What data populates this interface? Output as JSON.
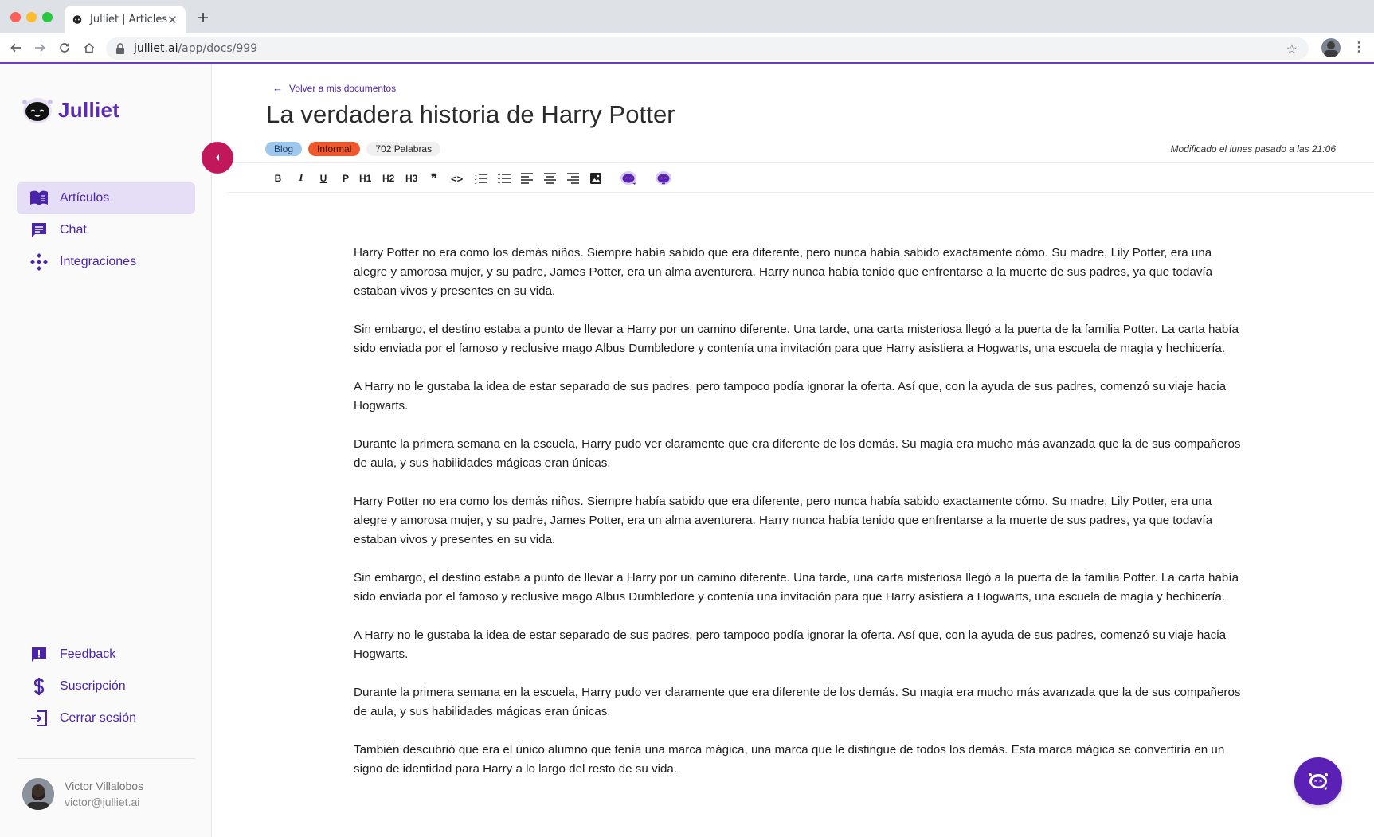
{
  "browser": {
    "tab_title": "Julliet | Articles",
    "tab_close": "✕",
    "new_tab": "+",
    "url_host": "julliet.ai",
    "url_path": "/app/docs/999"
  },
  "brand": {
    "name": "Julliet",
    "accent": "#5b2bb5",
    "collapse_color": "#c2185b"
  },
  "sidebar": {
    "nav": [
      {
        "label": "Artículos",
        "icon": "book-open-icon",
        "active": true
      },
      {
        "label": "Chat",
        "icon": "chat-icon",
        "active": false
      },
      {
        "label": "Integraciones",
        "icon": "integrations-icon",
        "active": false
      }
    ],
    "bottom": [
      {
        "label": "Feedback",
        "icon": "feedback-icon"
      },
      {
        "label": "Suscripción",
        "icon": "dollar-icon"
      },
      {
        "label": "Cerrar sesión",
        "icon": "logout-icon"
      }
    ],
    "user": {
      "name": "Victor Villalobos",
      "email": "victor@julliet.ai"
    }
  },
  "document": {
    "back_label": "Volver a mis documentos",
    "title": "La verdadera historia de Harry Potter",
    "tags": {
      "type": "Blog",
      "tone": "Informal",
      "words": "702 Palabras"
    },
    "modified": "Modificado el lunes pasado a las 21:06",
    "toolbar": {
      "bold": "B",
      "italic": "I",
      "underline": "U",
      "paragraph": "P",
      "h1": "H1",
      "h2": "H2",
      "h3": "H3",
      "quote": "❞",
      "code": "<>"
    },
    "paragraphs": [
      "Harry Potter no era como los demás niños. Siempre había sabido que era diferente, pero nunca había sabido exactamente cómo. Su madre, Lily Potter, era una alegre y amorosa mujer, y su padre, James Potter, era un alma aventurera. Harry nunca había tenido que enfrentarse a la muerte de sus padres, ya que todavía estaban vivos y presentes en su vida.",
      "Sin embargo, el destino estaba a punto de llevar a Harry por un camino diferente. Una tarde, una carta misteriosa llegó a la puerta de la familia Potter. La carta había sido enviada por el famoso y reclusive mago Albus Dumbledore y contenía una invitación para que Harry asistiera a Hogwarts, una escuela de magia y hechicería.",
      "A Harry no le gustaba la idea de estar separado de sus padres, pero tampoco podía ignorar la oferta. Así que, con la ayuda de sus padres, comenzó su viaje hacia Hogwarts.",
      "Durante la primera semana en la escuela, Harry pudo ver claramente que era diferente de los demás. Su magia era mucho más avanzada que la de sus compañeros de aula, y sus habilidades mágicas eran únicas.",
      "Harry Potter no era como los demás niños. Siempre había sabido que era diferente, pero nunca había sabido exactamente cómo. Su madre, Lily Potter, era una alegre y amorosa mujer, y su padre, James Potter, era un alma aventurera. Harry nunca había tenido que enfrentarse a la muerte de sus padres, ya que todavía estaban vivos y presentes en su vida.",
      "Sin embargo, el destino estaba a punto de llevar a Harry por un camino diferente. Una tarde, una carta misteriosa llegó a la puerta de la familia Potter. La carta había sido enviada por el famoso y reclusive mago Albus Dumbledore y contenía una invitación para que Harry asistiera a Hogwarts, una escuela de magia y hechicería.",
      "A Harry no le gustaba la idea de estar separado de sus padres, pero tampoco podía ignorar la oferta. Así que, con la ayuda de sus padres, comenzó su viaje hacia Hogwarts.",
      "Durante la primera semana en la escuela, Harry pudo ver claramente que era diferente de los demás. Su magia era mucho más avanzada que la de sus compañeros de aula, y sus habilidades mágicas eran únicas.",
      "También descubrió que era el único alumno que tenía una marca mágica, una marca que le distingue de todos los demás. Esta marca mágica se convertiría en un signo de identidad para Harry a lo largo del resto de su vida."
    ]
  }
}
